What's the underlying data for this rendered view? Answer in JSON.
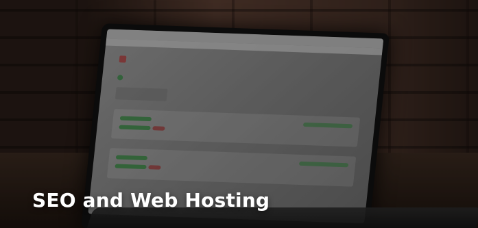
{
  "caption": {
    "title": "SEO and Web Hosting"
  },
  "photo": {
    "subject_icons": {
      "laptop": "laptop-icon"
    }
  }
}
